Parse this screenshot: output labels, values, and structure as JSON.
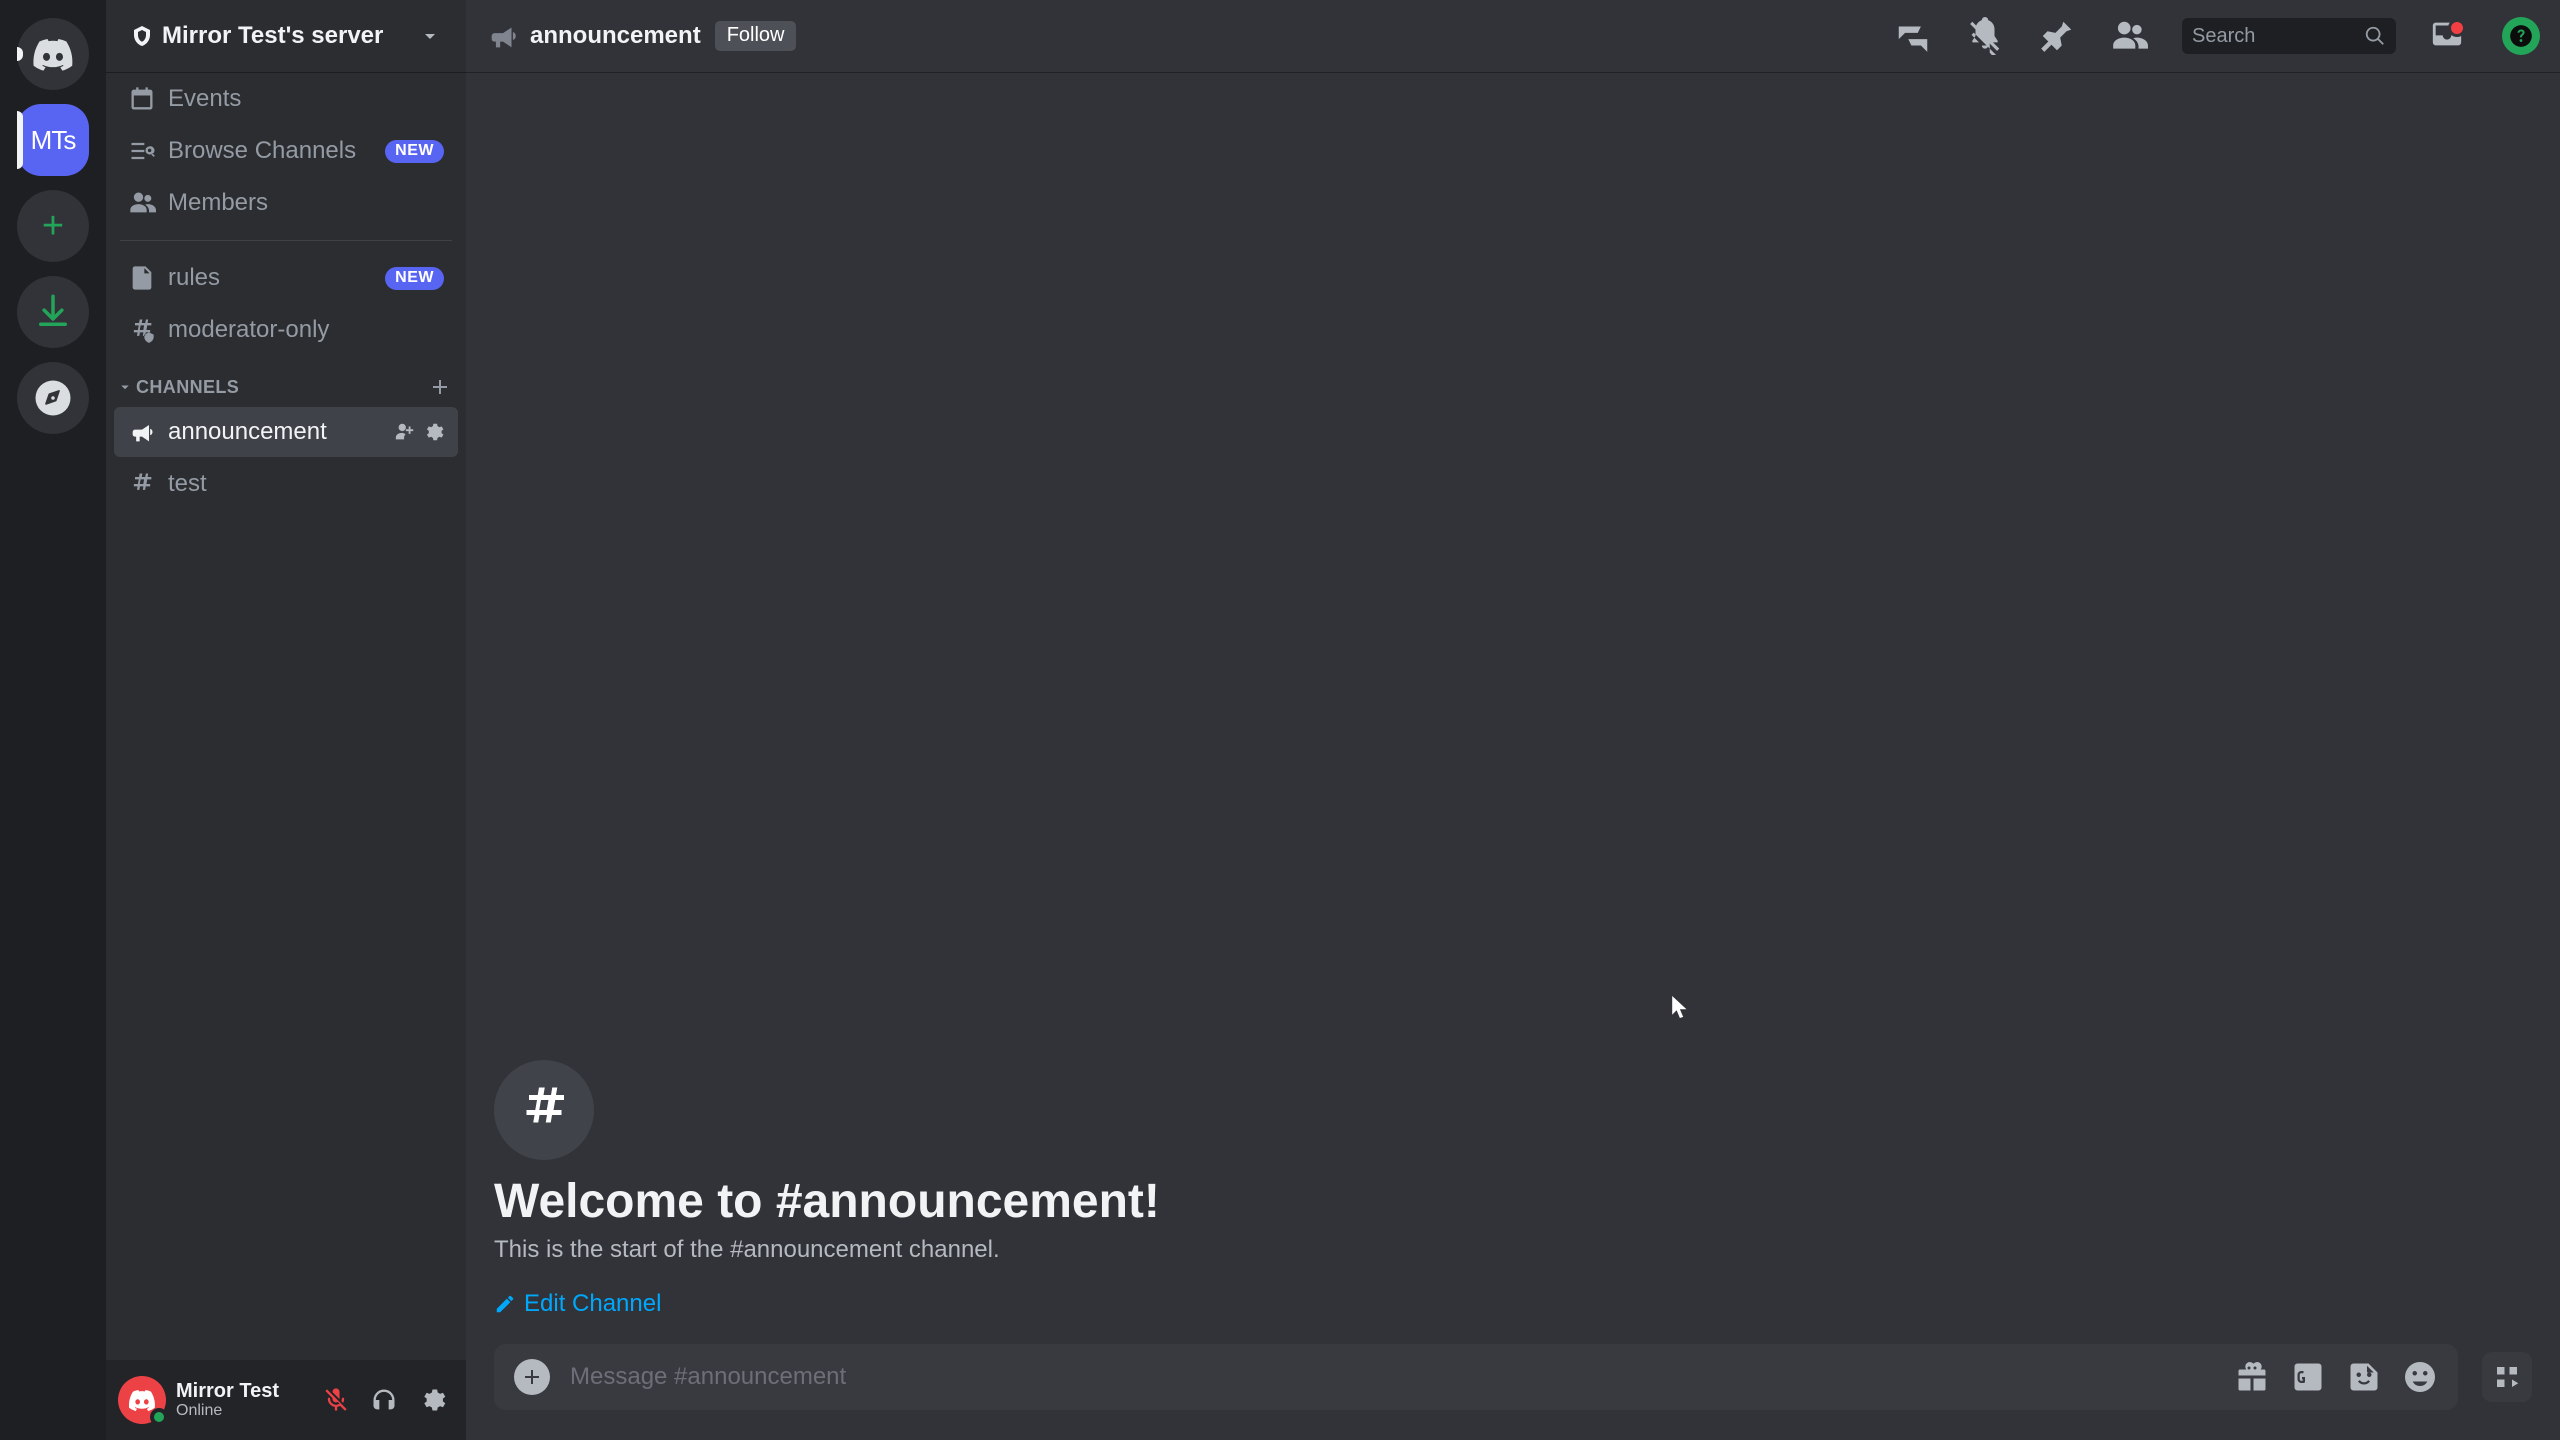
{
  "rail": {
    "home_label": "Home",
    "server_abbr": "MTs",
    "add_label": "+"
  },
  "server": {
    "name": "Mirror Test's server"
  },
  "nav": {
    "events": "Events",
    "browse": "Browse Channels",
    "browse_badge": "NEW",
    "members": "Members",
    "rules": "rules",
    "rules_badge": "NEW",
    "mod_only": "moderator-only",
    "category": "CHANNELS",
    "announcement": "announcement",
    "test": "test"
  },
  "user": {
    "name": "Mirror Test",
    "status": "Online"
  },
  "titlebar": {
    "channel": "announcement",
    "follow": "Follow",
    "search_placeholder": "Search"
  },
  "welcome": {
    "title": "Welcome to #announcement!",
    "subtitle": "This is the start of the #announcement channel.",
    "edit": "Edit Channel"
  },
  "composer": {
    "placeholder": "Message #announcement"
  }
}
